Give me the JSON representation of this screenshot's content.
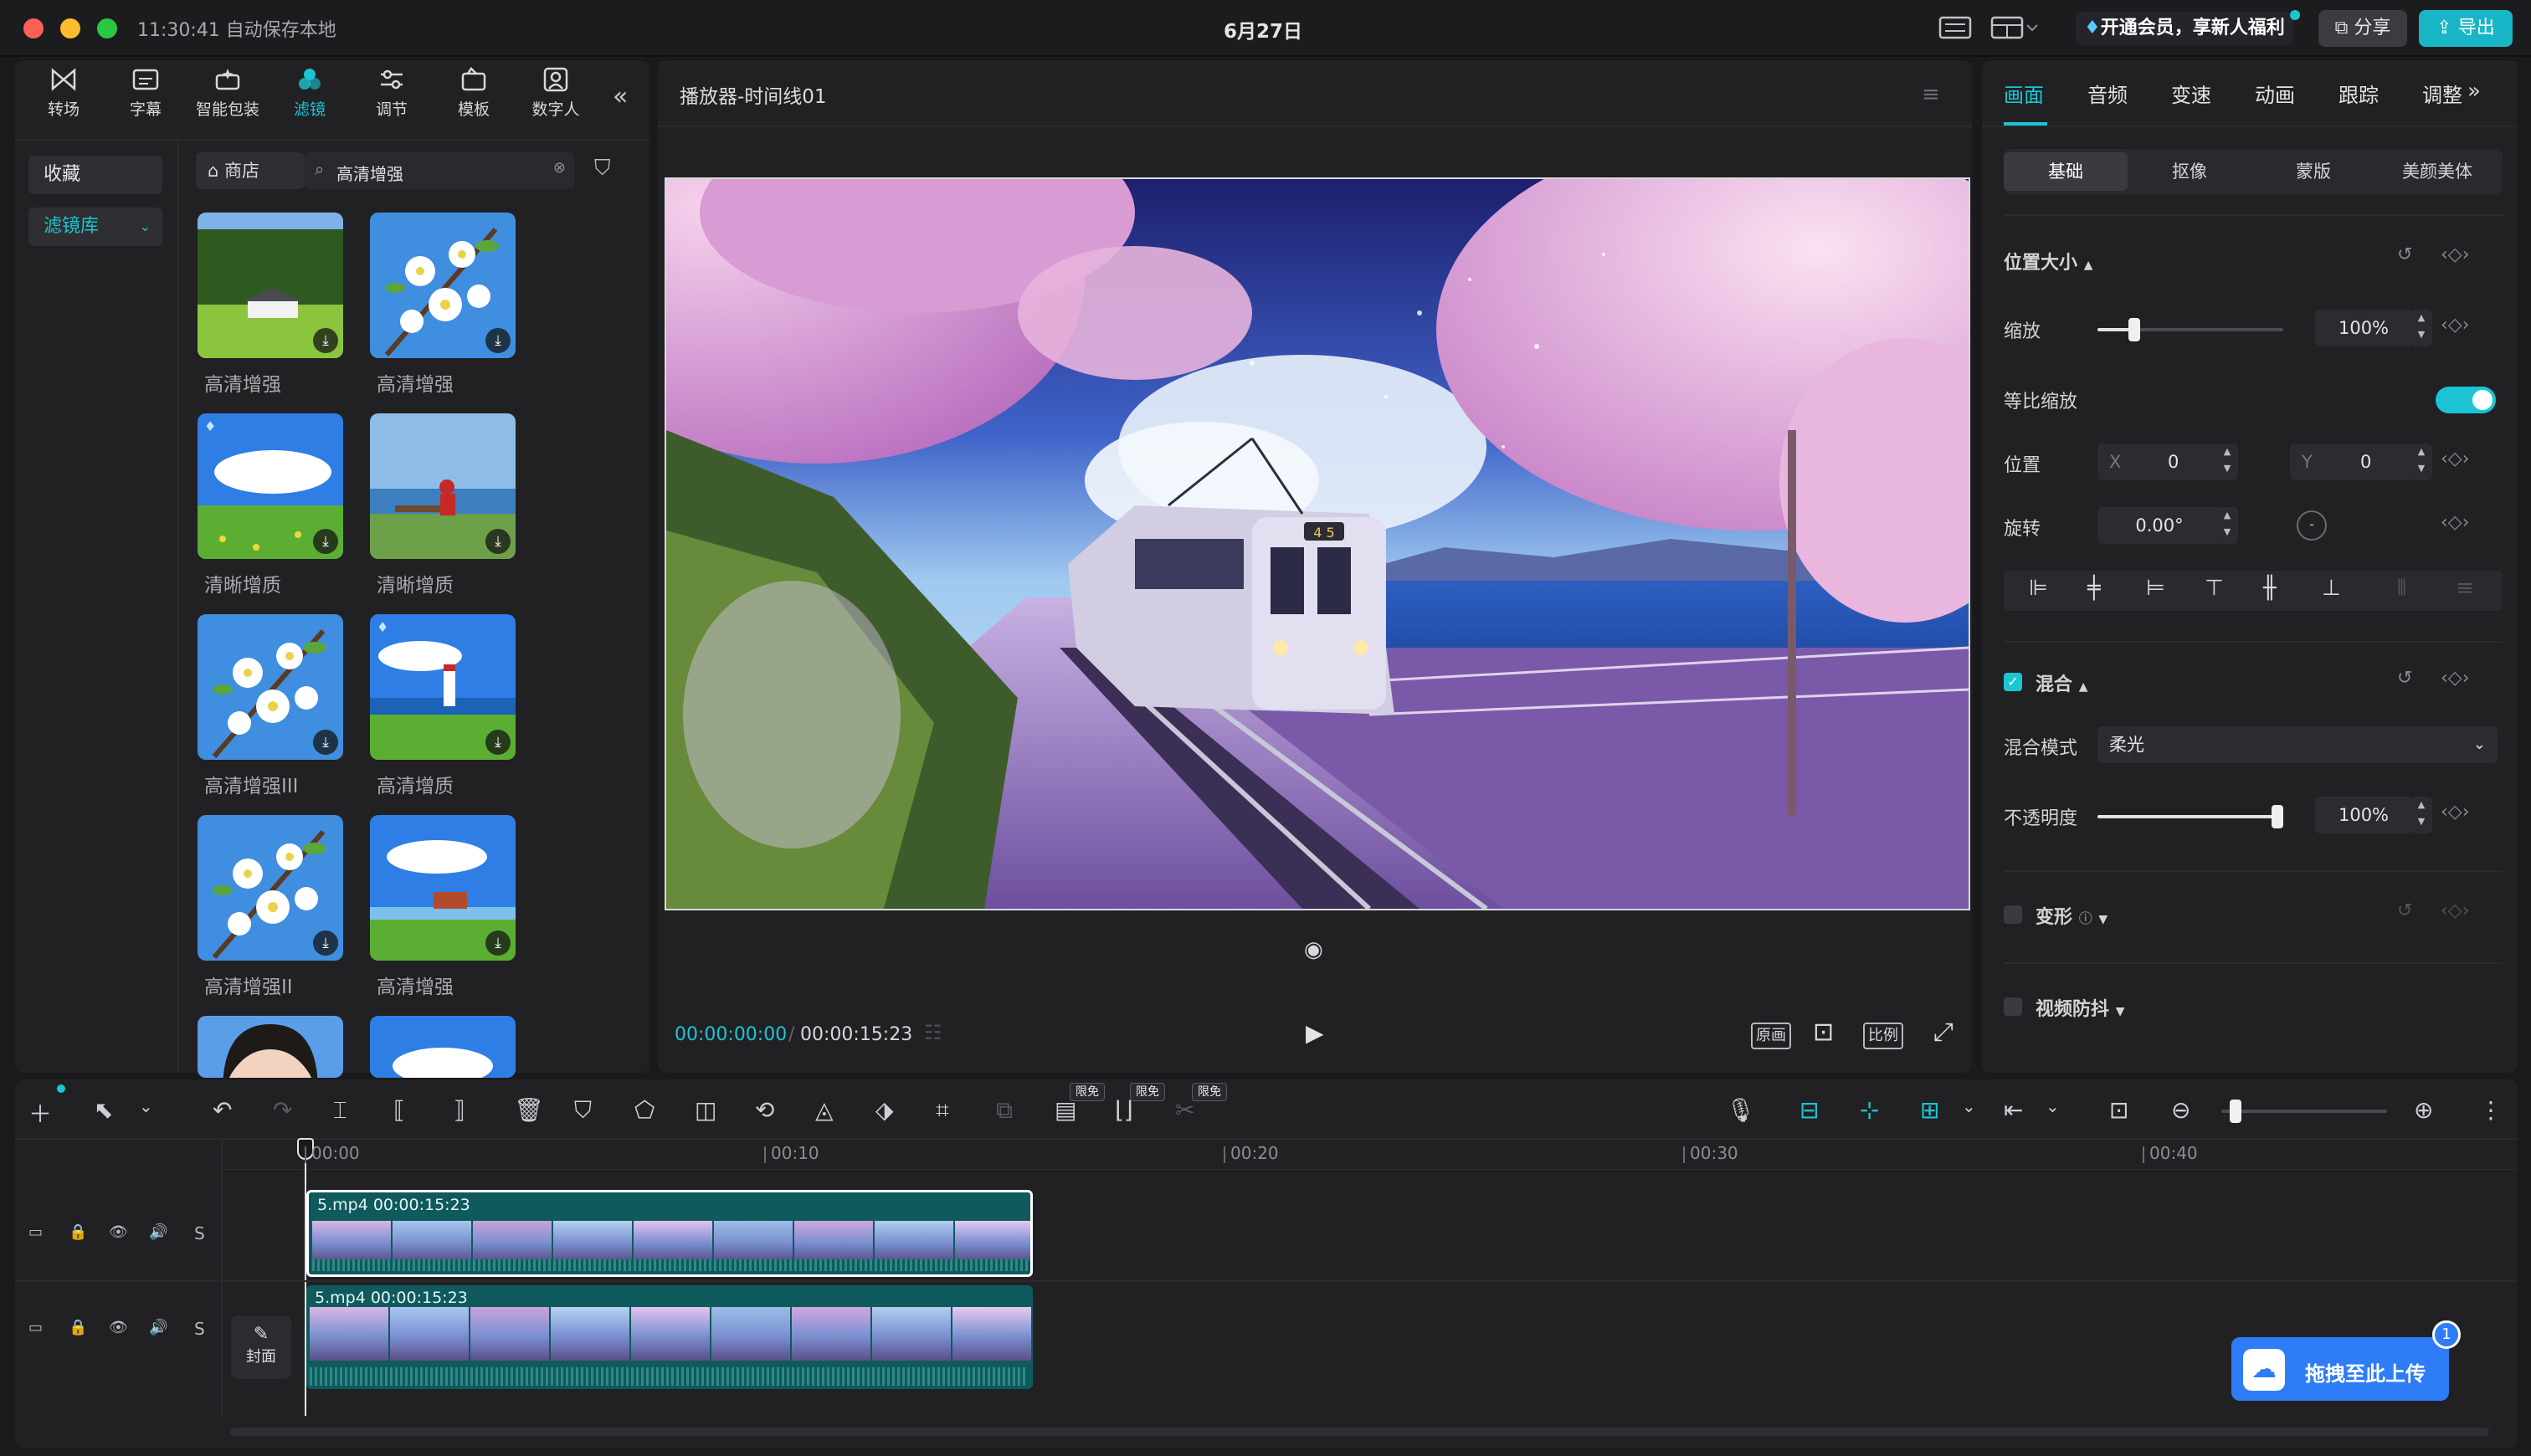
{
  "titlebar": {
    "status": "11:30:41 自动保存本地",
    "date": "6月27日",
    "vip_label": "开通会员，享新人福利",
    "share_label": "分享",
    "export_label": "导出"
  },
  "toolbar": {
    "items": [
      {
        "label": "转场",
        "icon": "transition-icon"
      },
      {
        "label": "字幕",
        "icon": "subtitle-icon"
      },
      {
        "label": "智能包装",
        "icon": "smart-pack-icon"
      },
      {
        "label": "滤镜",
        "icon": "filter-icon",
        "active": true
      },
      {
        "label": "调节",
        "icon": "adjust-icon"
      },
      {
        "label": "模板",
        "icon": "template-icon"
      },
      {
        "label": "数字人",
        "icon": "digital-human-icon"
      }
    ],
    "collapse": "«"
  },
  "sidebar": {
    "favorites": "收藏",
    "filter_library": "滤镜库"
  },
  "filter_panel": {
    "store_label": "商店",
    "search_value": "高清增强",
    "items": [
      {
        "label": "高清增强",
        "scene": "house"
      },
      {
        "label": "高清增强",
        "scene": "blossom"
      },
      {
        "label": "清晰增质",
        "scene": "meadow"
      },
      {
        "label": "清晰增质",
        "scene": "bench"
      },
      {
        "label": "高清增强III",
        "scene": "blossom"
      },
      {
        "label": "高清增质",
        "scene": "lighthouse"
      },
      {
        "label": "高清增强II",
        "scene": "blossom"
      },
      {
        "label": "高清增强",
        "scene": "lakehouse"
      },
      {
        "label": "",
        "scene": "portrait"
      },
      {
        "label": "",
        "scene": "flowers"
      }
    ]
  },
  "player": {
    "title": "播放器-时间线01",
    "current_time": "00:00:00:00",
    "total_time": "00:00:15:23",
    "btn_original": "原画",
    "btn_ratio": "比例",
    "train_sign": "4 5"
  },
  "right_panel": {
    "tabs": [
      "画面",
      "音频",
      "变速",
      "动画",
      "跟踪",
      "调整"
    ],
    "subtabs": [
      "基础",
      "抠像",
      "蒙版",
      "美颜美体"
    ],
    "section_position": "位置大小",
    "scale_label": "缩放",
    "scale_value": "100%",
    "scale_fraction": 0.2,
    "uniform_scale_label": "等比缩放",
    "uniform_scale_on": true,
    "position_label": "位置",
    "x_label": "X",
    "x_value": "0",
    "y_label": "Y",
    "y_value": "0",
    "rotation_label": "旋转",
    "rotation_value": "0.00°",
    "blend_section": "混合",
    "blend_enabled": true,
    "blend_mode_label": "混合模式",
    "blend_mode_value": "柔光",
    "opacity_label": "不透明度",
    "opacity_value": "100%",
    "opacity_fraction": 1.0,
    "transform_section": "变形",
    "stabilize_section": "视频防抖"
  },
  "timeline": {
    "ruler": [
      "00:00",
      "00:10",
      "00:20",
      "00:30",
      "00:40"
    ],
    "limited_badge": "限免",
    "tracks": [
      {
        "name": "5.mp4",
        "duration": "00:00:15:23",
        "selected": true
      },
      {
        "name": "5.mp4",
        "duration": "00:00:15:23",
        "selected": false
      }
    ],
    "track_ctrl_s": "S",
    "cover_label": "封面",
    "zoom_fraction": 0.05
  },
  "upload": {
    "label": "拖拽至此上传",
    "badge": "1"
  },
  "colors": {
    "accent": "#1bc5d4",
    "bg": "#1a1a1d",
    "panel": "#212124",
    "export": "#18b6c6",
    "upload": "#2e7cf6"
  }
}
